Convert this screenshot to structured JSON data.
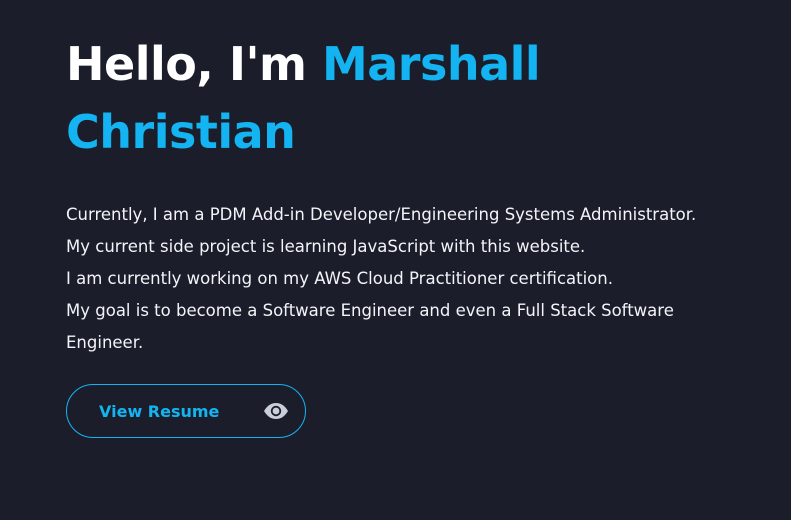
{
  "hero": {
    "greeting": "Hello, I'm ",
    "name_first": "Marshall",
    "name_last": "Christian",
    "accent_color": "#14b4f2"
  },
  "bio": {
    "lines": [
      "Currently, I am a PDM Add-in Developer/Engineering Systems Administrator.",
      "My current side project is learning JavaScript with this website.",
      "I am currently working on my AWS Cloud Practitioner certification.",
      "My goal is to become a Software Engineer and even a Full Stack Software",
      "Engineer."
    ]
  },
  "resume_button": {
    "label": "View Resume",
    "icon": "eye-icon"
  },
  "colors": {
    "background": "#1b1e2a",
    "text": "#ffffff",
    "accent": "#14b4f2",
    "icon": "#c9cfd8"
  }
}
